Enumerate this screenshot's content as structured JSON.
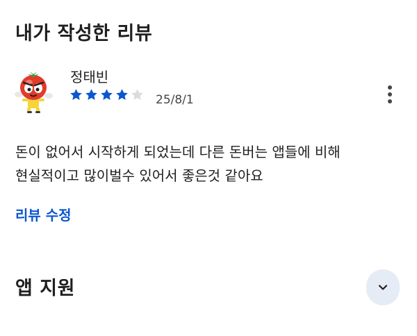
{
  "my_review": {
    "title": "내가 작성한 리뷰",
    "reviewer_name": "정태빈",
    "rating": 4,
    "max_rating": 5,
    "date": "25/8/1",
    "text_lines": [
      "돈이 없어서 시작하게 되었는데 다른 돈버는 앱들에 비해",
      "현실적이고 많이벌수 있어서 좋은것 같아요"
    ],
    "edit_label": "리뷰 수정",
    "more_icon": "more-vert-icon"
  },
  "app_support": {
    "title": "앱 지원",
    "expand_icon": "chevron-down-icon"
  },
  "colors": {
    "star_filled": "#0b57d0",
    "star_empty": "#dadce0",
    "link": "#0b57d0",
    "expand_bg": "#e6ecf5"
  }
}
